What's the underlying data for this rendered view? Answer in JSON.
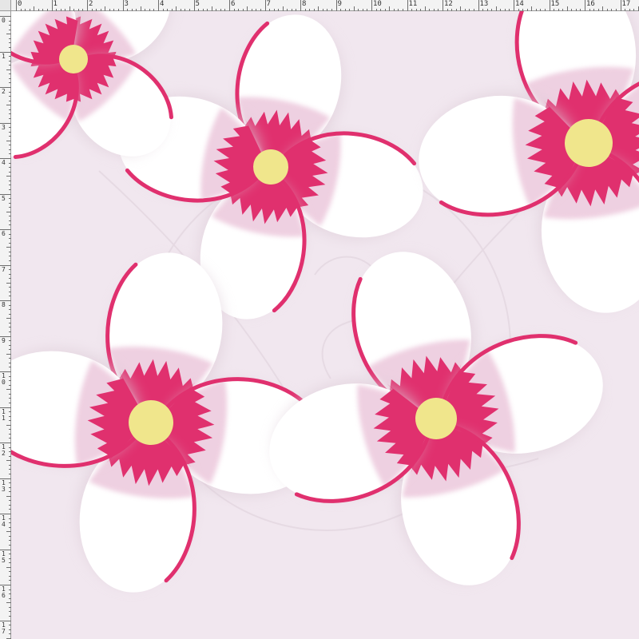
{
  "ruler": {
    "top_labels": [
      "0",
      "1",
      "2",
      "3",
      "4",
      "5",
      "6",
      "7",
      "8",
      "9",
      "10",
      "11",
      "12",
      "13",
      "14",
      "15",
      "16",
      "17"
    ],
    "left_labels": [
      "0",
      "1",
      "2",
      "3",
      "4",
      "5",
      "6",
      "7",
      "8",
      "9",
      "10",
      "11",
      "12",
      "13",
      "14",
      "15",
      "16",
      "17"
    ]
  },
  "artwork": {
    "background_color": "#f1e7ef",
    "petal_color": "#ffffff",
    "blush_color": "#ecc8dc",
    "accent_color": "#e0306e",
    "center_color": "#f0e68c",
    "watermark_icon": "bird-watermark-icon"
  }
}
